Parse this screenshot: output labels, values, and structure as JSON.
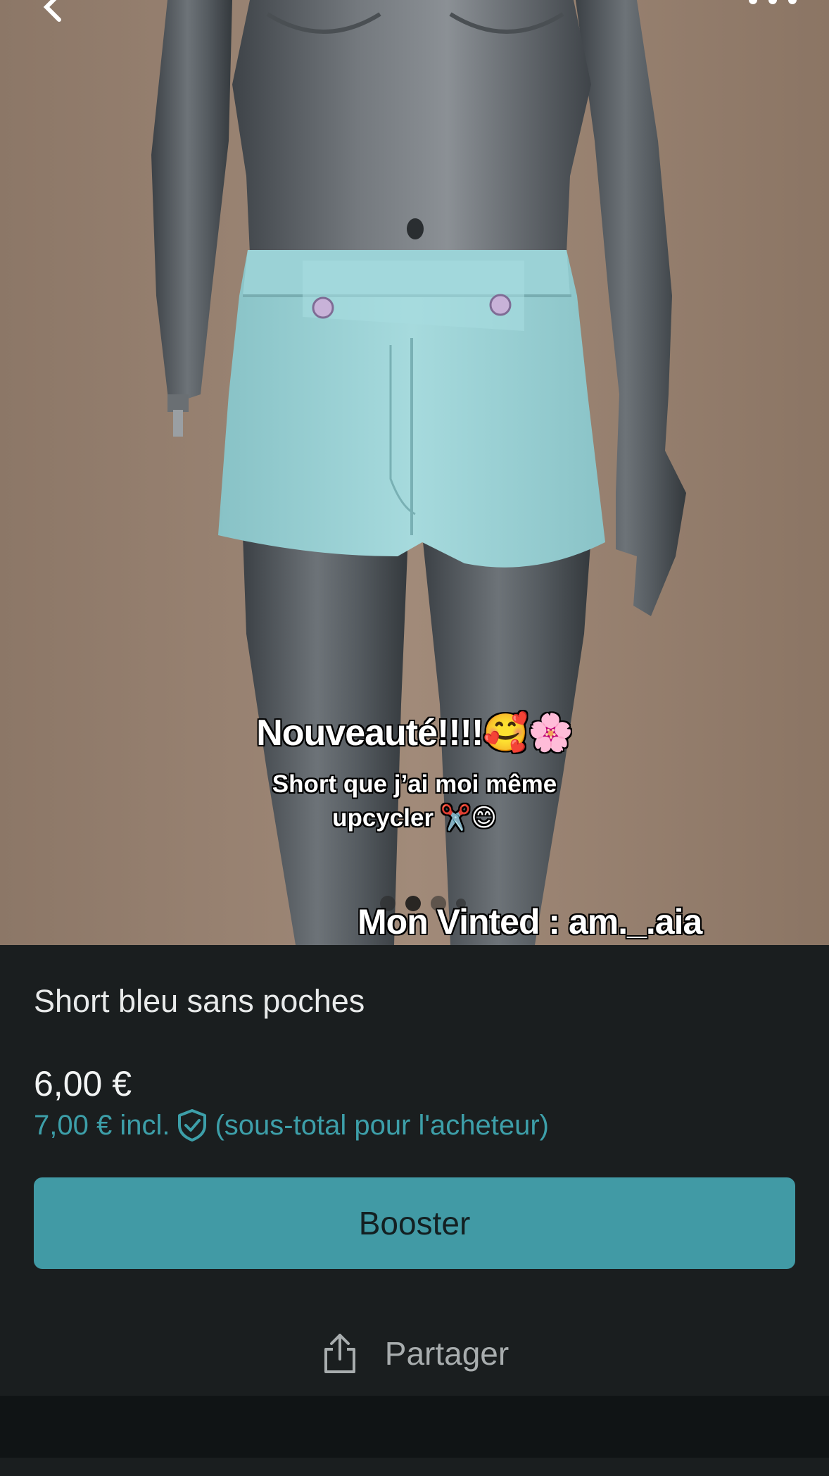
{
  "photo": {
    "caption_title": "Nouveauté!!!!🥰🌸",
    "caption_line1": "Short que j’ai moi même",
    "caption_line2": "upcycler ✂️😊",
    "caption_vinted": "Mon Vinted : am._.aia",
    "dots_count": 4,
    "active_dot": 1
  },
  "listing": {
    "title": "Short bleu sans poches",
    "price": "6,00 €",
    "buyer_price": "7,00 € incl.",
    "buyer_note": "(sous-total pour l'acheteur)"
  },
  "actions": {
    "booster_label": "Booster",
    "share_label": "Partager"
  },
  "colors": {
    "accent": "#419aa5",
    "accent_text": "#3d9fa9",
    "panel_bg": "#1a1e1f",
    "garment": "#9cd3d7"
  },
  "icons": {
    "back": "back-arrow-icon",
    "more": "more-dots-icon",
    "shield": "shield-check-icon",
    "share": "share-icon"
  }
}
